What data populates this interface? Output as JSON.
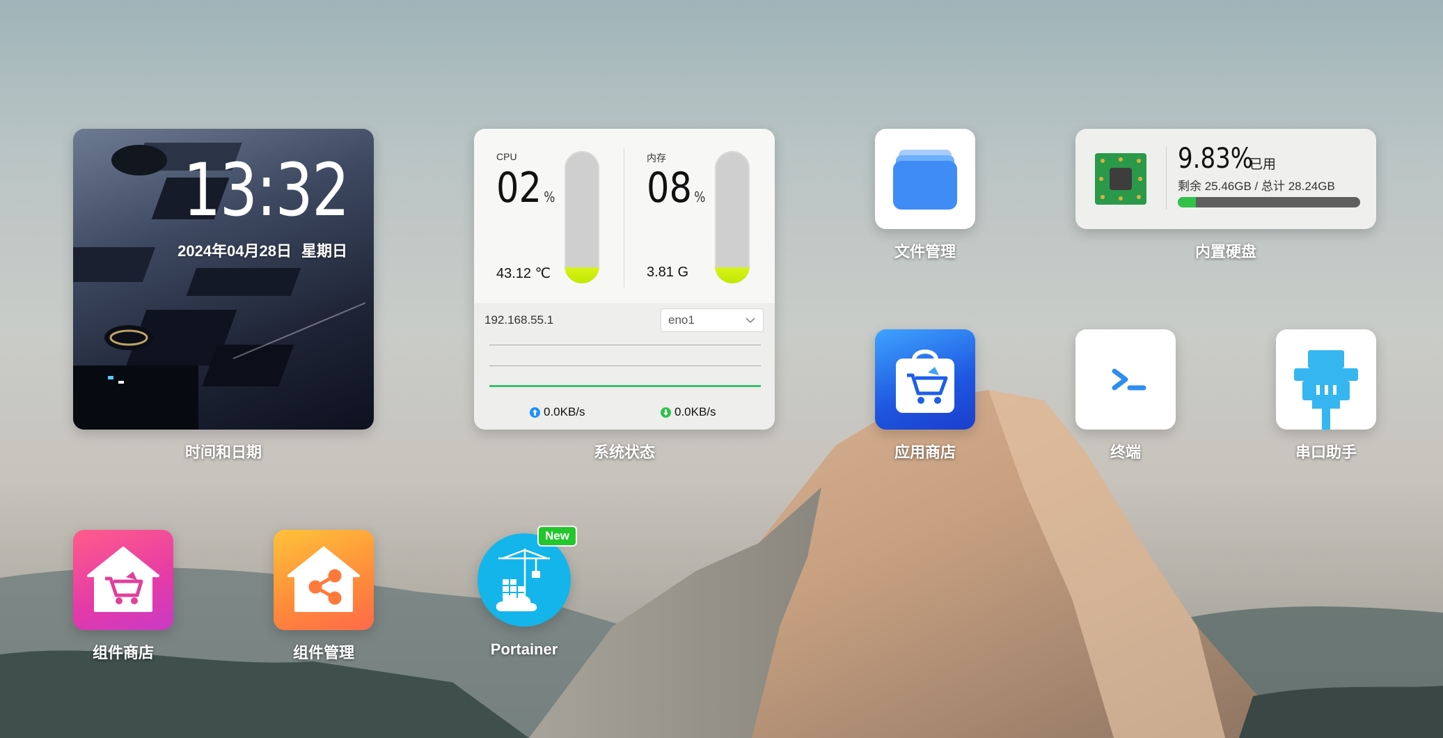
{
  "clock": {
    "time": "13:32",
    "date": "2024年04月28日",
    "weekday": "星期日",
    "label": "时间和日期"
  },
  "system": {
    "label": "系统状态",
    "cpu": {
      "name": "CPU",
      "value": "02",
      "unit": "%",
      "temperature": "43.12 ℃",
      "level": 0.02
    },
    "memory": {
      "name": "内存",
      "value": "08",
      "unit": "%",
      "total": "3.81 G",
      "level": 0.08
    },
    "network": {
      "ip": "192.168.55.1",
      "interface": "eno1",
      "upload": "0.0KB/s",
      "download": "0.0KB/s"
    }
  },
  "apps": {
    "file_manager": {
      "label": "文件管理",
      "icon": "folder-icon"
    },
    "app_store": {
      "label": "应用商店",
      "icon": "shopping-bag-icon"
    },
    "terminal": {
      "label": "终端",
      "icon": "terminal-icon"
    },
    "serial": {
      "label": "串口助手",
      "icon": "serial-port-icon"
    },
    "widget_store": {
      "label": "组件商店",
      "icon": "house-cart-icon"
    },
    "widget_manager": {
      "label": "组件管理",
      "icon": "house-share-icon"
    },
    "portainer": {
      "label": "Portainer",
      "badge": "New",
      "icon": "portainer-crane-icon"
    }
  },
  "disk": {
    "label": "内置硬盘",
    "percent": "9.83%",
    "used_label": "已用",
    "info": "剩余 25.46GB / 总计 28.24GB",
    "level": 0.0983
  },
  "colors": {
    "gauge_fill": "#c3e800",
    "net_line": "#3cc06d",
    "disk_fill": "#31c24a",
    "badge": "#22c72b"
  }
}
